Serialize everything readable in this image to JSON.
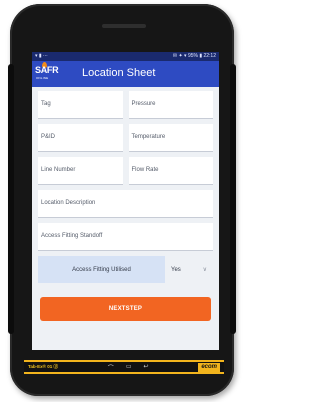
{
  "status_bar": {
    "left": "▾ ▮ ⋯",
    "right": "✉ ✦ ▾ 95% ▮ 22:12"
  },
  "header": {
    "logo_text": "SAFR",
    "logo_subtext": "ONLINE",
    "title": "Location Sheet"
  },
  "form": {
    "fields": {
      "tag": "Tag",
      "pressure": "Pressure",
      "pid": "P&ID",
      "temperature": "Temperature",
      "line_number": "Line Number",
      "flow_rate": "Flow Rate",
      "location_description": "Location Description",
      "access_fitting_standoff": "Access Fitting Standoff"
    },
    "access_fitting_utilised": {
      "label": "Access Fitting Utilised",
      "value": "Yes"
    }
  },
  "next_button": {
    "label_prefix": "NEXT ",
    "label_bold": "STEP"
  },
  "device": {
    "model_label": "Tab-Ex® 01 ⓓ",
    "brand": "ecom"
  },
  "colors": {
    "status_bar": "#1a2a6e",
    "app_bar": "#2e4bc2",
    "primary_button": "#f26522",
    "device_accent": "#f2b41d"
  }
}
